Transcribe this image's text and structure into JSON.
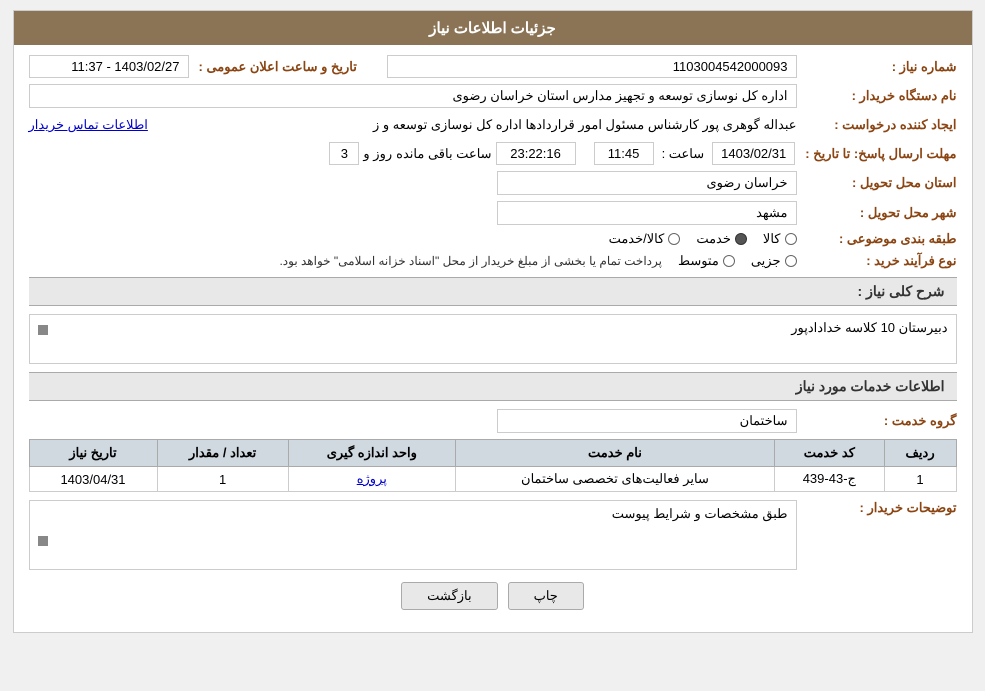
{
  "header": {
    "title": "جزئیات اطلاعات نیاز"
  },
  "fields": {
    "need_number_label": "شماره نیاز :",
    "need_number_value": "1103004542000093",
    "buyer_org_label": "نام دستگاه خریدار :",
    "buyer_org_value": "اداره کل نوسازی  توسعه و تجهیز مدارس استان خراسان رضوی",
    "creator_label": "ایجاد کننده درخواست :",
    "creator_value": "عبداله گوهری پور کارشناس مسئول امور قراردادها  اداره کل نوسازی  توسعه و ز",
    "contact_info_label": "اطلاعات تماس خریدار",
    "send_deadline_label": "مهلت ارسال پاسخ: تا تاریخ :",
    "deadline_date": "1403/02/31",
    "deadline_time_label": "ساعت :",
    "deadline_time": "11:45",
    "deadline_day_label": "روز و",
    "deadline_days": "3",
    "deadline_remaining_label": "ساعت باقی مانده",
    "deadline_clock": "23:22:16",
    "province_label": "استان محل تحویل :",
    "province_value": "خراسان رضوی",
    "city_label": "شهر محل تحویل :",
    "city_value": "مشهد",
    "classification_label": "طبقه بندی موضوعی :",
    "classification_kala": "کالا",
    "classification_khadamat": "خدمت",
    "classification_kala_khadamat": "کالا/خدمت",
    "process_label": "نوع فرآیند خرید :",
    "process_jozi": "جزیی",
    "process_motovaset": "متوسط",
    "process_note": "پرداخت تمام یا بخشی از مبلغ خریدار از محل \"اسناد خزانه اسلامی\" خواهد بود.",
    "announcement_label": "تاریخ و ساعت اعلان عمومی :",
    "announcement_value": "1403/02/27 - 11:37",
    "need_description_label": "شرح کلی نیاز :",
    "need_description_value": "دبیرستان 10 کلاسه خدادادپور",
    "services_section_title": "اطلاعات خدمات مورد نیاز",
    "service_group_label": "گروه خدمت :",
    "service_group_value": "ساختمان",
    "table": {
      "headers": [
        "ردیف",
        "کد خدمت",
        "نام خدمت",
        "واحد اندازه گیری",
        "تعداد / مقدار",
        "تاریخ نیاز"
      ],
      "rows": [
        {
          "row": "1",
          "code": "ج-43-439",
          "name": "سایر فعالیت‌های تخصصی ساختمان",
          "unit": "پروژه",
          "quantity": "1",
          "date": "1403/04/31"
        }
      ]
    },
    "buyer_desc_label": "توضیحات خریدار :",
    "buyer_desc_value": "طبق مشخصات و شرایط پیوست"
  },
  "buttons": {
    "print_label": "چاپ",
    "back_label": "بازگشت"
  },
  "colors": {
    "header_bg": "#8B7355",
    "label_color": "#8B4513",
    "table_header_bg": "#d0d8e0",
    "contact_link_color": "#0000cc"
  }
}
